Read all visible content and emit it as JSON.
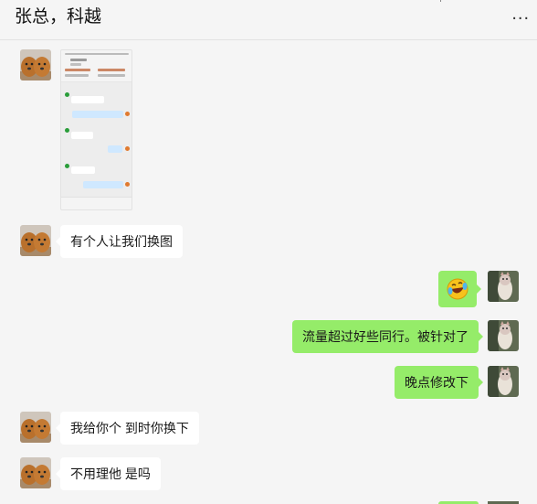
{
  "chat": {
    "title": "张总，科越",
    "more_label": "..."
  },
  "messages": [
    {
      "side": "left",
      "type": "image",
      "description_icon": "screenshot-thumbnail"
    },
    {
      "side": "left",
      "type": "text",
      "text": "有个人让我们换图"
    },
    {
      "side": "right",
      "type": "emoji",
      "icon": "laugh-cry-emoji-icon"
    },
    {
      "side": "right",
      "type": "text",
      "text": "流量超过好些同行。被针对了"
    },
    {
      "side": "right",
      "type": "text",
      "text": "晚点修改下"
    },
    {
      "side": "left",
      "type": "text",
      "text": "我给你个 到时你换下"
    },
    {
      "side": "left",
      "type": "text",
      "text": "不用理他 是吗"
    }
  ],
  "colors": {
    "background": "#f5f5f5",
    "self_bubble": "#95ec69",
    "other_bubble": "#ffffff"
  }
}
